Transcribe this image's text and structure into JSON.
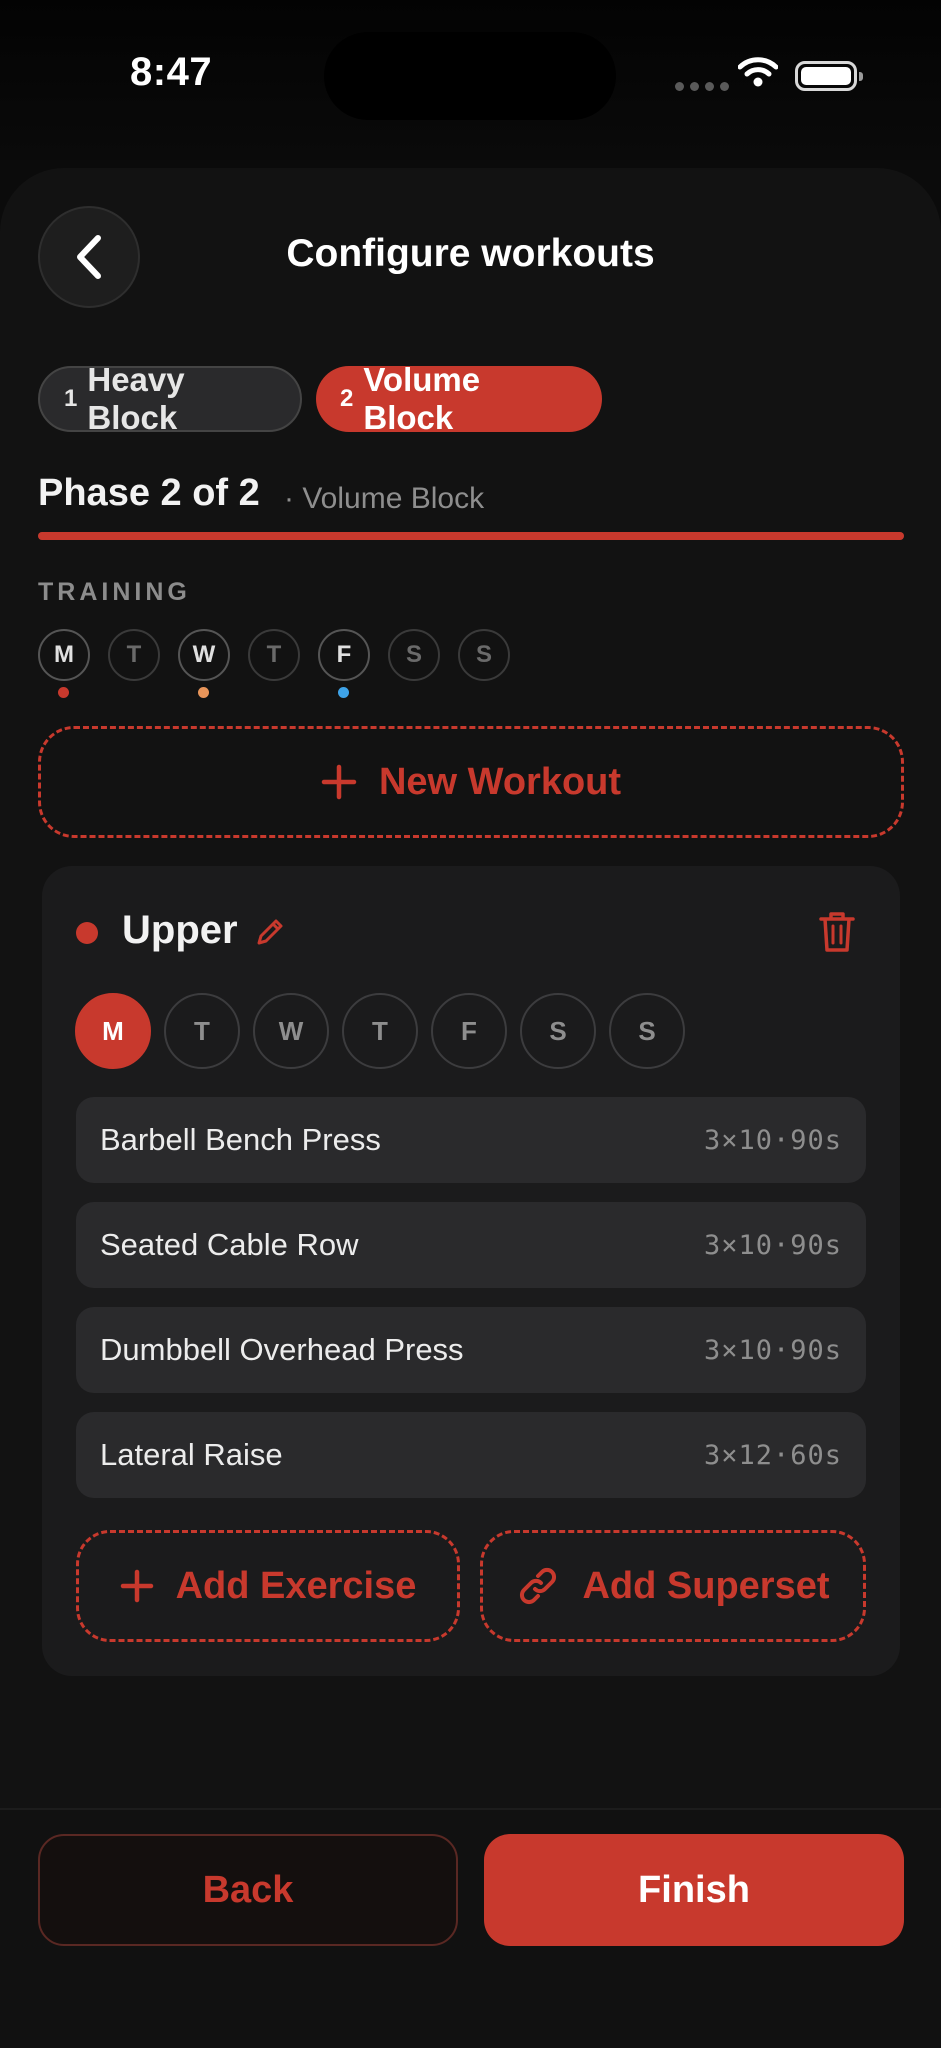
{
  "status_bar": {
    "time": "8:47"
  },
  "header": {
    "title": "Configure workouts"
  },
  "phases": [
    {
      "number": "1",
      "label": "Heavy Block",
      "selected": false
    },
    {
      "number": "2",
      "label": "Volume Block",
      "selected": true
    }
  ],
  "phase_info": {
    "title": "Phase 2 of 2",
    "subtitle": "· Volume Block",
    "progress": 1.0
  },
  "training": {
    "label": "TRAINING",
    "days": [
      "M",
      "T",
      "W",
      "T",
      "F",
      "S",
      "S"
    ],
    "dot_colors": {
      "0": "#c8392d",
      "2": "#e8955a",
      "4": "#3ea3e8"
    }
  },
  "new_workout": {
    "label": "New Workout"
  },
  "workout": {
    "name": "Upper",
    "color": "#c8392d",
    "days": [
      "M",
      "T",
      "W",
      "T",
      "F",
      "S",
      "S"
    ],
    "selected_day_index": 0,
    "exercises": [
      {
        "name": "Barbell Bench Press",
        "spec": "3×10·90s"
      },
      {
        "name": "Seated Cable Row",
        "spec": "3×10·90s"
      },
      {
        "name": "Dumbbell Overhead Press",
        "spec": "3×10·90s"
      },
      {
        "name": "Lateral Raise",
        "spec": "3×12·60s"
      }
    ],
    "add_exercise_label": "Add Exercise",
    "add_superset_label": "Add Superset"
  },
  "footer": {
    "back_label": "Back",
    "finish_label": "Finish"
  },
  "colors": {
    "accent": "#c8392d",
    "background": "#121212",
    "card": "#1b1b1c"
  }
}
